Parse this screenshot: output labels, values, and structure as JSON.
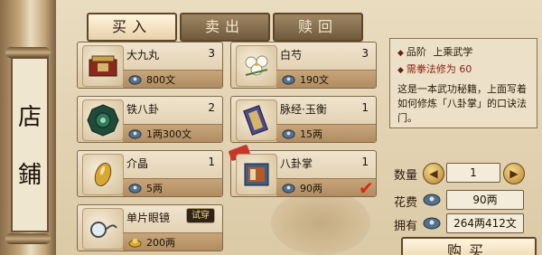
{
  "title_chars": [
    "店",
    "鋪"
  ],
  "tabs": [
    {
      "label": "买入",
      "active": true
    },
    {
      "label": "卖出",
      "active": false
    },
    {
      "label": "赎回",
      "active": false
    }
  ],
  "items": [
    {
      "name": "大九丸",
      "qty": "3",
      "price": "800文",
      "icon": "pill-box-icon"
    },
    {
      "name": "白芍",
      "qty": "3",
      "price": "190文",
      "icon": "white-peony-flower-icon"
    },
    {
      "name": "铁八卦",
      "qty": "2",
      "price": "1两300文",
      "icon": "iron-bagua-icon"
    },
    {
      "name": "脉经·玉衡",
      "qty": "1",
      "price": "15两",
      "icon": "scroll-book-icon"
    },
    {
      "name": "介晶",
      "qty": "1",
      "price": "5两",
      "icon": "gold-crystal-icon"
    },
    {
      "name": "八卦掌",
      "qty": "1",
      "price": "90两",
      "icon": "martial-manual-icon"
    },
    {
      "name": "单片眼镜",
      "qty": "",
      "price": "200两",
      "icon": "monocle-icon",
      "tag": "试穿"
    }
  ],
  "info": {
    "grade_label": "品阶",
    "grade_value": "上乘武学",
    "req_text": "需拳法修为 60",
    "desc": "这是一本武功秘籍，上面写着如何修炼「八卦掌」的口诀法门。"
  },
  "quantity": {
    "label": "数量",
    "value": "1"
  },
  "cost": {
    "label": "花费",
    "value": "90两"
  },
  "owned": {
    "label": "拥有",
    "value": "264两412文"
  },
  "buy_button": "购买",
  "colors": {
    "accent_red": "#c8362a",
    "panel_bg": "#e9dcc0",
    "border": "#5e4629"
  }
}
